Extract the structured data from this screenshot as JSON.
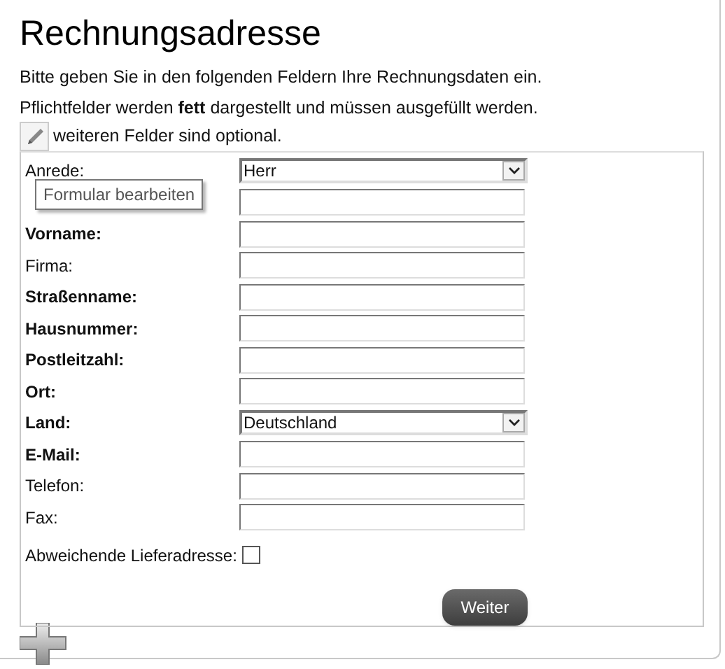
{
  "title": "Rechnungsadresse",
  "intro": "Bitte geben Sie in den folgenden Feldern Ihre Rechnungsdaten ein.",
  "note": "Pflichtfelder werden **fett** dargestellt und müssen ausgefüllt werden.",
  "note2": "weiteren Felder sind optional.",
  "tooltip": "Formular bearbeiten",
  "fields": [
    {
      "kind": "select",
      "label": "Anrede:",
      "required": false,
      "value": "Herr"
    },
    {
      "kind": "text"
    },
    {
      "kind": "text",
      "label": "Vorname:",
      "required": true
    },
    {
      "kind": "text",
      "label": "Firma:",
      "required": false
    },
    {
      "kind": "text",
      "label": "Straßenname:",
      "required": true
    },
    {
      "kind": "text",
      "label": "Hausnummer:",
      "required": true
    },
    {
      "kind": "text",
      "label": "Postleitzahl:",
      "required": true
    },
    {
      "kind": "text",
      "label": "Ort:",
      "required": true
    },
    {
      "kind": "select",
      "label": "Land:",
      "required": true,
      "value": "Deutschland"
    },
    {
      "kind": "text",
      "label": "E-Mail:",
      "required": true
    },
    {
      "kind": "text",
      "label": "Telefon:",
      "required": false
    },
    {
      "kind": "text",
      "label": "Fax:",
      "required": false
    },
    {
      "kind": "checkbox",
      "label": "Abweichende Lieferadresse:",
      "required": false,
      "checked": false
    }
  ],
  "button": "Weiter"
}
